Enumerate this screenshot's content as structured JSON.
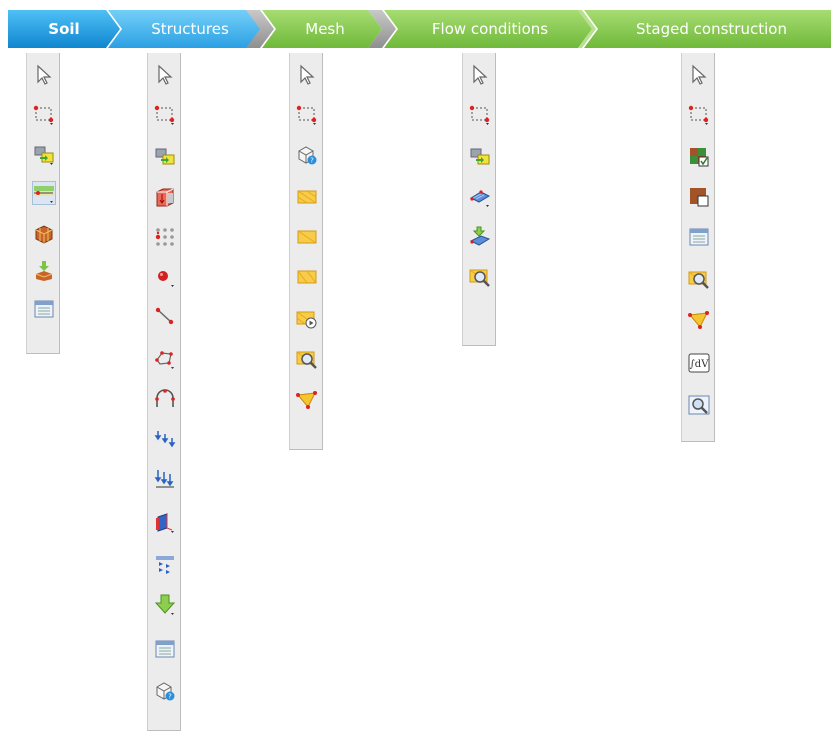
{
  "tabs": [
    {
      "label": "Soil",
      "color": "#1e9fe6",
      "active": true
    },
    {
      "label": "Structures",
      "color": "#46b2ee",
      "active": false
    },
    {
      "label": "Mesh",
      "color": "#7cc443",
      "active": false
    },
    {
      "label": "Flow conditions",
      "color": "#8acd4f",
      "active": false
    },
    {
      "label": "Staged construction",
      "color": "#94d25a",
      "active": false
    }
  ],
  "toolbars": {
    "soil": {
      "tools": [
        {
          "icon": "select-pointer-icon"
        },
        {
          "icon": "select-rectangle-icon"
        },
        {
          "icon": "copy-move-icon"
        },
        {
          "icon": "borehole-icon",
          "pressed": true
        },
        {
          "icon": "soil-volume-icon"
        },
        {
          "icon": "import-soil-icon"
        },
        {
          "icon": "table-icon"
        }
      ]
    },
    "structures": {
      "tools": [
        {
          "icon": "select-pointer-icon"
        },
        {
          "icon": "select-rectangle-icon"
        },
        {
          "icon": "copy-move-icon"
        },
        {
          "icon": "surface-load-icon"
        },
        {
          "icon": "array-icon"
        },
        {
          "icon": "point-icon"
        },
        {
          "icon": "line-icon"
        },
        {
          "icon": "polygon-icon"
        },
        {
          "icon": "tunnel-icon"
        },
        {
          "icon": "point-load-icon"
        },
        {
          "icon": "line-load-icon"
        },
        {
          "icon": "plate-icon"
        },
        {
          "icon": "water-flow-icon"
        },
        {
          "icon": "import-arrow-icon"
        },
        {
          "icon": "table-icon"
        },
        {
          "icon": "mesh-check-icon"
        }
      ]
    },
    "mesh": {
      "tools": [
        {
          "icon": "select-pointer-icon"
        },
        {
          "icon": "select-rectangle-icon"
        },
        {
          "icon": "mesh-check-icon"
        },
        {
          "icon": "refine-mesh-icon"
        },
        {
          "icon": "coarsen-mesh-icon"
        },
        {
          "icon": "reset-refinement-icon"
        },
        {
          "icon": "generate-mesh-icon"
        },
        {
          "icon": "view-mesh-icon"
        },
        {
          "icon": "select-points-curves-icon"
        }
      ]
    },
    "flow": {
      "tools": [
        {
          "icon": "select-pointer-icon"
        },
        {
          "icon": "select-rectangle-icon"
        },
        {
          "icon": "copy-move-icon"
        },
        {
          "icon": "water-level-icon"
        },
        {
          "icon": "import-water-level-icon"
        },
        {
          "icon": "preview-flow-icon"
        }
      ]
    },
    "staged": {
      "tools": [
        {
          "icon": "select-pointer-icon"
        },
        {
          "icon": "select-rectangle-icon"
        },
        {
          "icon": "toggle-activate-icon"
        },
        {
          "icon": "change-material-icon"
        },
        {
          "icon": "table-icon"
        },
        {
          "icon": "preview-phase-icon"
        },
        {
          "icon": "select-points-curves-icon"
        },
        {
          "icon": "integral-dv-icon"
        },
        {
          "icon": "view-output-icon"
        }
      ]
    }
  }
}
